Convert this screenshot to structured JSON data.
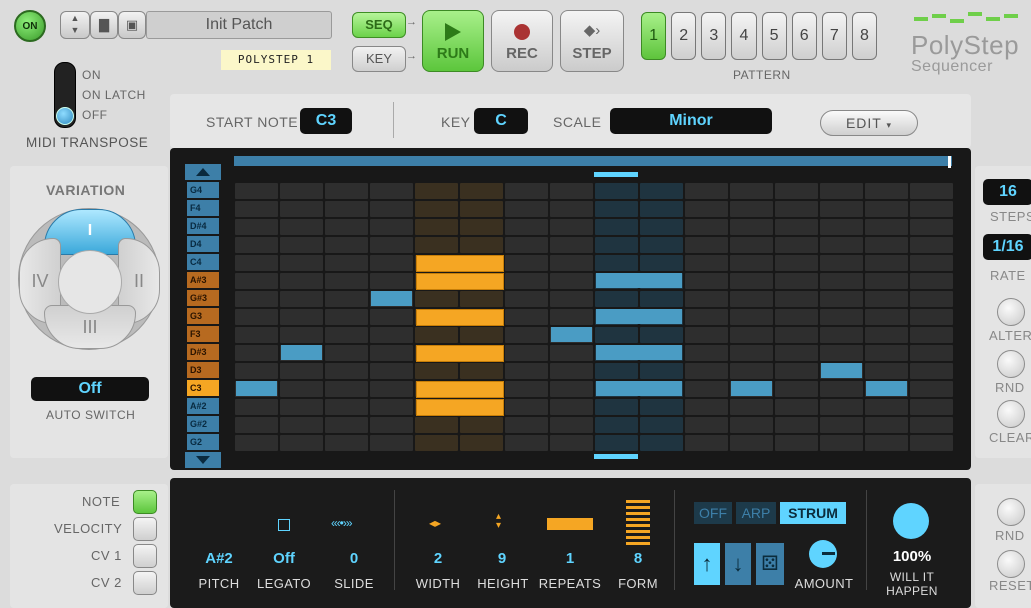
{
  "header": {
    "power": "ON",
    "patch_name": "Init Patch",
    "tape_label": "POLYSTEP 1",
    "seq": "SEQ",
    "key_btn": "KEY",
    "run": "RUN",
    "rec": "REC",
    "step": "STEP",
    "pattern_label": "PATTERN",
    "patterns": [
      "1",
      "2",
      "3",
      "4",
      "5",
      "6",
      "7",
      "8"
    ],
    "brand_line1": "PolyStep",
    "brand_line2": "Sequencer"
  },
  "transpose": {
    "on": "ON",
    "on_latch": "ON LATCH",
    "off": "OFF",
    "label": "MIDI TRANSPOSE"
  },
  "toolbar": {
    "start_note_label": "START NOTE",
    "start_note": "C3",
    "key_label": "KEY",
    "key": "C",
    "scale_label": "SCALE",
    "scale": "Minor",
    "edit": "EDIT"
  },
  "variation": {
    "label": "VARIATION",
    "I": "I",
    "II": "II",
    "III": "III",
    "IV": "IV",
    "auto_switch_value": "Off",
    "auto_switch_label": "AUTO SWITCH"
  },
  "rows": [
    "G4",
    "F4",
    "D#4",
    "D4",
    "C4",
    "A#3",
    "G#3",
    "G3",
    "F3",
    "D#3",
    "D3",
    "C3",
    "A#2",
    "G#2",
    "G2"
  ],
  "right": {
    "steps_value": "16",
    "steps_label": "STEPS",
    "rate_value": "1/16",
    "rate_label": "RATE",
    "alter": "ALTER",
    "rnd": "RND",
    "clear": "CLEAR",
    "rnd2": "RND",
    "reset": "RESET"
  },
  "lanes": {
    "note": "NOTE",
    "velocity": "VELOCITY",
    "cv1": "CV 1",
    "cv2": "CV 2"
  },
  "bottom": {
    "pitch_value": "A#2",
    "pitch": "PITCH",
    "legato_value": "Off",
    "legato": "LEGATO",
    "slide_value": "0",
    "slide": "SLIDE",
    "width_value": "2",
    "width": "WIDTH",
    "height_value": "9",
    "height": "HEIGHT",
    "repeats_value": "1",
    "repeats": "REPEATS",
    "form_value": "8",
    "form": "FORM",
    "mode_off": "OFF",
    "mode_arp": "ARP",
    "mode_strum": "STRUM",
    "amount": "AMOUNT",
    "chance_value": "100%",
    "chance_line1": "WILL IT",
    "chance_line2": "HAPPEN"
  }
}
